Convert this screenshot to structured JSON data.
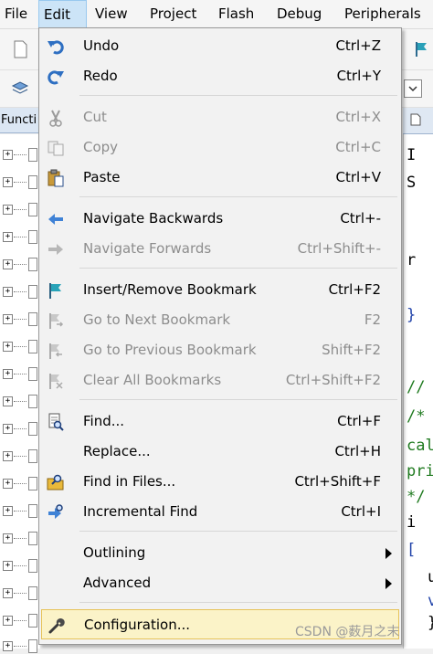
{
  "menubar": {
    "items": [
      {
        "label": "File"
      },
      {
        "label": "Edit"
      },
      {
        "label": "View"
      },
      {
        "label": "Project"
      },
      {
        "label": "Flash"
      },
      {
        "label": "Debug"
      },
      {
        "label": "Peripherals"
      }
    ]
  },
  "panel": {
    "tab_label": "Functi"
  },
  "editor": {
    "code_lines": [
      "I",
      "S",
      "r",
      "}",
      "//",
      "/*",
      "cal",
      "pri",
      "*/",
      "i",
      "[",
      "u",
      "v",
      "}"
    ]
  },
  "edit_menu": {
    "items": [
      {
        "label": "Undo",
        "shortcut": "Ctrl+Z",
        "icon": "undo-icon"
      },
      {
        "label": "Redo",
        "shortcut": "Ctrl+Y",
        "icon": "redo-icon"
      },
      {
        "label": "Cut",
        "shortcut": "Ctrl+X",
        "icon": "cut-icon"
      },
      {
        "label": "Copy",
        "shortcut": "Ctrl+C",
        "icon": "copy-icon"
      },
      {
        "label": "Paste",
        "shortcut": "Ctrl+V",
        "icon": "paste-icon"
      },
      {
        "label": "Navigate Backwards",
        "shortcut": "Ctrl+-",
        "icon": "navigate-back-icon"
      },
      {
        "label": "Navigate Forwards",
        "shortcut": "Ctrl+Shift+-",
        "icon": "navigate-forward-icon"
      },
      {
        "label": "Insert/Remove Bookmark",
        "shortcut": "Ctrl+F2",
        "icon": "bookmark-icon"
      },
      {
        "label": "Go to Next Bookmark",
        "shortcut": "F2",
        "icon": "next-bookmark-icon"
      },
      {
        "label": "Go to Previous Bookmark",
        "shortcut": "Shift+F2",
        "icon": "previous-bookmark-icon"
      },
      {
        "label": "Clear All Bookmarks",
        "shortcut": "Ctrl+Shift+F2",
        "icon": "clear-bookmarks-icon"
      },
      {
        "label": "Find...",
        "shortcut": "Ctrl+F",
        "icon": "find-icon"
      },
      {
        "label": "Replace...",
        "shortcut": "Ctrl+H"
      },
      {
        "label": "Find in Files...",
        "shortcut": "Ctrl+Shift+F",
        "icon": "find-in-files-icon"
      },
      {
        "label": "Incremental Find",
        "shortcut": "Ctrl+I",
        "icon": "incremental-find-icon"
      },
      {
        "label": "Outlining"
      },
      {
        "label": "Advanced"
      },
      {
        "label": "Configuration...",
        "icon": "wrench-icon"
      }
    ]
  },
  "watermark": "CSDN @薮月之末"
}
